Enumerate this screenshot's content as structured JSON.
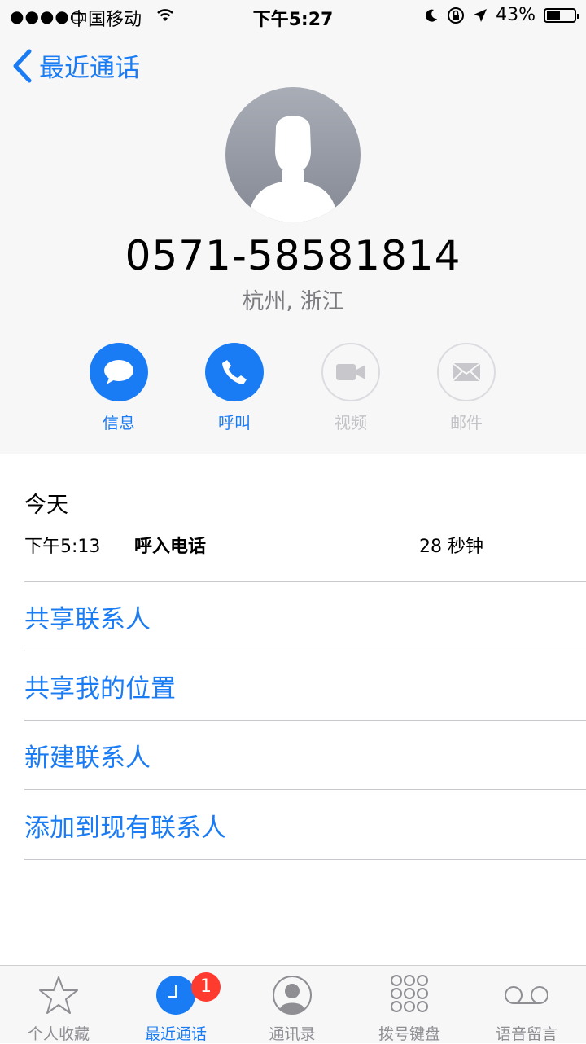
{
  "status_bar": {
    "signal": "●●●●○",
    "carrier": "中国移动",
    "time": "下午5:27",
    "battery": "43%",
    "battery_level": 0.43
  },
  "nav": {
    "back_label": "最近通话"
  },
  "contact": {
    "number": "0571-58581814",
    "location": "杭州, 浙江"
  },
  "actions": [
    {
      "label": "信息",
      "icon": "message-icon",
      "enabled": true
    },
    {
      "label": "呼叫",
      "icon": "phone-icon",
      "enabled": true
    },
    {
      "label": "视频",
      "icon": "video-icon",
      "enabled": false
    },
    {
      "label": "邮件",
      "icon": "mail-icon",
      "enabled": false
    }
  ],
  "recent": {
    "day": "今天",
    "calls": [
      {
        "time": "下午5:13",
        "type": "呼入电话",
        "duration": "28 秒钟"
      }
    ]
  },
  "options": [
    {
      "label": "共享联系人"
    },
    {
      "label": "共享我的位置"
    },
    {
      "label": "新建联系人"
    },
    {
      "label": "添加到现有联系人"
    }
  ],
  "tabbar": {
    "items": [
      {
        "label": "个人收藏",
        "icon": "star-icon"
      },
      {
        "label": "最近通话",
        "icon": "clock-icon",
        "badge": "1",
        "active": true
      },
      {
        "label": "通讯录",
        "icon": "contacts-icon"
      },
      {
        "label": "拨号键盘",
        "icon": "keypad-icon"
      },
      {
        "label": "语音留言",
        "icon": "voicemail-icon"
      }
    ]
  },
  "colors": {
    "accent": "#1a7cf5",
    "badge": "#ff3b30",
    "disabled": "#c2c2c6"
  }
}
